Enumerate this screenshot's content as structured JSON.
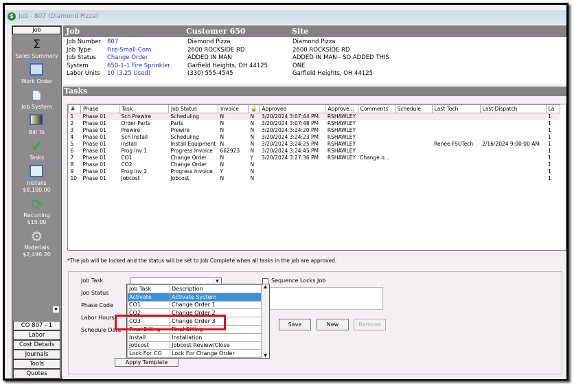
{
  "window": {
    "title": "Job - 807 (Diamond Pizza)"
  },
  "sidebar": {
    "header": "Job",
    "items": [
      {
        "label": "Sales Summary",
        "icon": "sigma-icon"
      },
      {
        "label": "Work Order",
        "icon": "work-order-icon"
      },
      {
        "label": "Job System",
        "icon": "job-system-icon"
      },
      {
        "label": "Bill To",
        "icon": "bill-to-icon"
      },
      {
        "label": "Tasks",
        "icon": "checkmark-icon"
      },
      {
        "label": "Installs",
        "value": "$8,100.00",
        "icon": "installs-icon"
      },
      {
        "label": "Recurring",
        "value": "$15.00",
        "icon": "recurring-icon"
      },
      {
        "label": "Materials",
        "value": "$2,496.20",
        "icon": "gear-icon"
      }
    ],
    "buttons": [
      "CO 807 - 1",
      "Labor",
      "Cost Details",
      "Journals",
      "Tools",
      "Quotes"
    ]
  },
  "header": {
    "job": "Job",
    "customer": "Customer 650",
    "site": "Site"
  },
  "job": {
    "labels": [
      "Job Number",
      "Job Type",
      "Job Status",
      "System",
      "Labor Units"
    ],
    "values": [
      "807",
      "Fire-Small-Com",
      "Change Order",
      "650-1-1 Fire Sprinkler",
      "10 (3.25 Used)"
    ]
  },
  "customer": {
    "lines": [
      "Diamond Pizza",
      "2600 ROCKSIDE RD",
      "ADDED IN MAN",
      "Garfield Heights, OH  44125",
      "(330) 555-4545"
    ]
  },
  "site": {
    "lines": [
      "Diamond Pizza",
      "2600 ROCKSIDE RD",
      "ADDED IN MAN - SO ADDED THIS",
      "ONE",
      "Garfield Heights, OH  44125"
    ]
  },
  "tasks": {
    "title": "Tasks",
    "columns": [
      "#",
      "Phase",
      "Task",
      "Job Status",
      "Invoice",
      "",
      "Approved",
      "Approve...",
      "Comments",
      "Schedule",
      "Last Tech",
      "Last Dispatch",
      "La"
    ],
    "rows": [
      [
        "1",
        "Phase 01",
        "Sch Prewire",
        "Scheduling",
        "N",
        "N",
        "3/20/2024 3:07:44 PM",
        "RSHAWLEY",
        "",
        "",
        "",
        "",
        "1"
      ],
      [
        "2",
        "Phase 01",
        "Order Parts",
        "Parts",
        "N",
        "N",
        "3/20/2024 3:07:48 PM",
        "RSHAWLEY",
        "",
        "",
        "",
        "",
        "1"
      ],
      [
        "3",
        "Phase 01",
        "Prewire",
        "Prewire",
        "N",
        "N",
        "3/20/2024 3:24:20 PM",
        "RSHAWLEY",
        "",
        "",
        "",
        "",
        "1"
      ],
      [
        "4",
        "Phase 01",
        "Sch Install",
        "Scheduling",
        "N",
        "N",
        "3/20/2024 3:24:23 PM",
        "RSHAWLEY",
        "",
        "",
        "",
        "",
        "1"
      ],
      [
        "5",
        "Phase 01",
        "Install",
        "Install Equipment",
        "N",
        "N",
        "3/20/2024 3:24:25 PM",
        "RSHAWLEY",
        "",
        "",
        "Renee.FSUTech",
        "2/16/2024 9:00:00 AM",
        "1"
      ],
      [
        "6",
        "Phase 01",
        "Prog Inv 1",
        "Progress Invoice",
        "662923",
        "N",
        "3/20/2024 3:24:45 PM",
        "RSHAWLEY",
        "",
        "",
        "",
        "",
        "1"
      ],
      [
        "7",
        "Phase 01",
        "CO1",
        "Change Order",
        "N",
        "Y",
        "3/20/2024 3:27:36 PM",
        "RSHAWLEY",
        "Change o...",
        "",
        "",
        "",
        "1"
      ],
      [
        "8",
        "Phase 01",
        "CO2",
        "Change Order",
        "N",
        "N",
        "",
        "",
        "",
        "",
        "",
        "",
        "1"
      ],
      [
        "9",
        "Phase 01",
        "Prog Inv 2",
        "Progress Invoice",
        "Y",
        "N",
        "",
        "",
        "",
        "",
        "",
        "",
        "1"
      ],
      [
        "10",
        "Phase 01",
        "Jobcost",
        "Jobcost",
        "N",
        "N",
        "",
        "",
        "",
        "",
        "",
        "",
        "1"
      ]
    ]
  },
  "note": "*The job will be locked and the status will be set to Job Complete when all tasks in the job are approved.",
  "form": {
    "labels": [
      "Job Task",
      "Job Status",
      "Phase Code",
      "Labor Hours",
      "Schedule Date"
    ],
    "job_task_value": "",
    "sequence_locks": "Sequence Locks Job",
    "save": "Save",
    "new": "New",
    "remove": "Remove",
    "apply_template": "Apply Template"
  },
  "dropdown": {
    "columns": [
      "Job Task",
      "Description"
    ],
    "rows": [
      [
        "Activate",
        "Activate System"
      ],
      [
        "CO1",
        "Change Order 1"
      ],
      [
        "CO2",
        "Change Order 2"
      ],
      [
        "CO3",
        "Change Order 3"
      ],
      [
        "Final Billing",
        "Final Billing"
      ],
      [
        "Install",
        "Installation"
      ],
      [
        "Jobcost",
        "Jobcost Review/Close"
      ],
      [
        "Lock For CO",
        "Lock For Change Order"
      ]
    ],
    "highlighted": "Activate",
    "annotated": "CO3"
  },
  "colors": {
    "header_gray": "#858285",
    "highlight": "#3a8fd8",
    "annotation": "#e0101a"
  }
}
